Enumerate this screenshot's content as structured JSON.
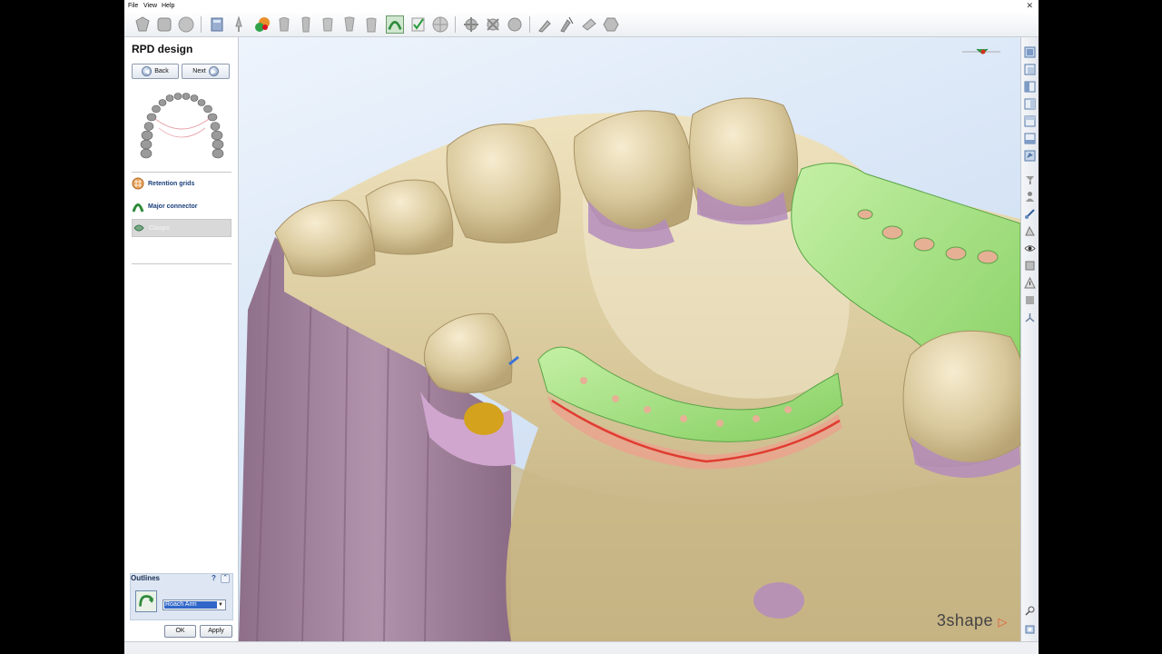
{
  "menu": {
    "items": [
      "File",
      "View",
      "Help"
    ],
    "close_glyph": "✕"
  },
  "toolbar": {
    "icons": [
      "scan-icon",
      "crown-icon",
      "round-icon",
      "model-icon",
      "pin-icon",
      "paint-icon",
      "tooth-1-icon",
      "tooth-2-icon",
      "tooth-3-icon",
      "tooth-4-icon",
      "tooth-5-icon",
      "rpd-icon",
      "check-icon",
      "sphere-icon",
      "gear-1-icon",
      "gear-2-icon",
      "gear-3-icon",
      "pen-icon",
      "cursor-icon",
      "arrow-icon",
      "hex-icon"
    ],
    "active_icon": "rpd-icon"
  },
  "panel": {
    "title": "RPD design",
    "back_label": "Back",
    "next_label": "Next",
    "steps": [
      {
        "label": "Retention grids",
        "icon": "retention-grid-icon"
      },
      {
        "label": "Major connector",
        "icon": "major-connector-icon"
      },
      {
        "label": "Clasps",
        "icon": "clasp-icon",
        "state": "active"
      }
    ],
    "outlines": {
      "title": "Outlines",
      "help": "?",
      "collapse": "⌃",
      "selected_value": "Roach Arm",
      "ok_label": "OK",
      "apply_label": "Apply"
    }
  },
  "viewport": {
    "logo_text": "3shape",
    "colors": {
      "model": "#d8c99e",
      "undercut": "#b893b5",
      "connector": "#9ed97e",
      "clasp_line": "#e03c30"
    }
  },
  "right_toolbar": {
    "icons": [
      "view-front-icon",
      "view-back-icon",
      "view-left-icon",
      "view-right-icon",
      "view-top-icon",
      "view-bottom-icon",
      "view-iso-icon",
      "pin-tool-icon",
      "person-icon",
      "measure-icon",
      "mesh-icon",
      "eye-icon",
      "layer-icon",
      "warning-icon",
      "box-icon",
      "axis-icon",
      "zoom-icon",
      "settings-icon"
    ]
  }
}
